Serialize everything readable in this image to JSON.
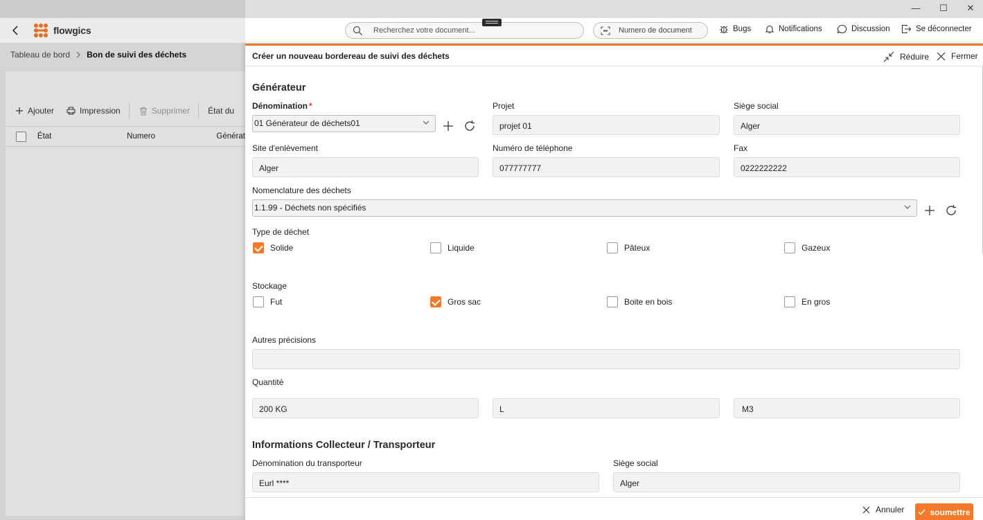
{
  "window": {
    "minimize_glyph": "—",
    "maximize_glyph": "☐",
    "close_glyph": "✕"
  },
  "app": {
    "name": "flowgics",
    "brand_color": "#f47a2a"
  },
  "search": {
    "placeholder": "Recherchez votre document..."
  },
  "docnum": {
    "placeholder": "Numero de document"
  },
  "topnav": {
    "bugs": "Bugs",
    "notifications": "Notifications",
    "discussion": "Discussion",
    "logout": "Se déconnecter"
  },
  "breadcrumb": {
    "home": "Tableau de bord",
    "current": "Bon de suivi des déchets"
  },
  "toolbar": {
    "add": "Ajouter",
    "print": "Impression",
    "delete": "Supprimer",
    "state": "État du"
  },
  "grid": {
    "columns": [
      "État",
      "Numero",
      "Générat"
    ]
  },
  "modal": {
    "title": "Créer un nouveau bordereau de suivi des déchets",
    "reduce": "Réduire",
    "close": "Fermer",
    "generator": {
      "section": "Générateur",
      "denomination_label": "Dénomination",
      "denomination_required": "*",
      "denomination_value": "01 Générateur de déchets01",
      "projet_label": "Projet",
      "projet_value": "projet 01",
      "siege_label": "Siège social",
      "siege_value": "Alger",
      "site_label": "Site d'enlèvement",
      "site_value": "Alger",
      "tel_label": "Numéro de téléphone",
      "tel_value": "077777777",
      "fax_label": "Fax",
      "fax_value": "0222222222",
      "nomenclature_label": "Nomenclature des déchets",
      "nomenclature_value": "1.1.99 - Déchets non spécifiés",
      "type_label": "Type de déchet",
      "types": [
        {
          "label": "Solide",
          "checked": true
        },
        {
          "label": "Liquide",
          "checked": false
        },
        {
          "label": "Pâteux",
          "checked": false
        },
        {
          "label": "Gazeux",
          "checked": false
        }
      ],
      "stockage_label": "Stockage",
      "stockage": [
        {
          "label": "Fut",
          "checked": false
        },
        {
          "label": "Gros sac",
          "checked": true
        },
        {
          "label": "Boite en bois",
          "checked": false
        },
        {
          "label": "En gros",
          "checked": false
        }
      ],
      "autres_label": "Autres précisions",
      "autres_value": "",
      "quantite_label": "Quantité",
      "quantite_values": [
        "200 KG",
        "L",
        "M3"
      ]
    },
    "collector": {
      "section": "Informations Collecteur / Transporteur",
      "denom_label": "Dénomination du transporteur",
      "denom_value": "Eurl ****",
      "siege_label": "Siège social",
      "siege_value": "Alger"
    },
    "footer": {
      "cancel": "Annuler",
      "submit": "soumettre"
    }
  }
}
